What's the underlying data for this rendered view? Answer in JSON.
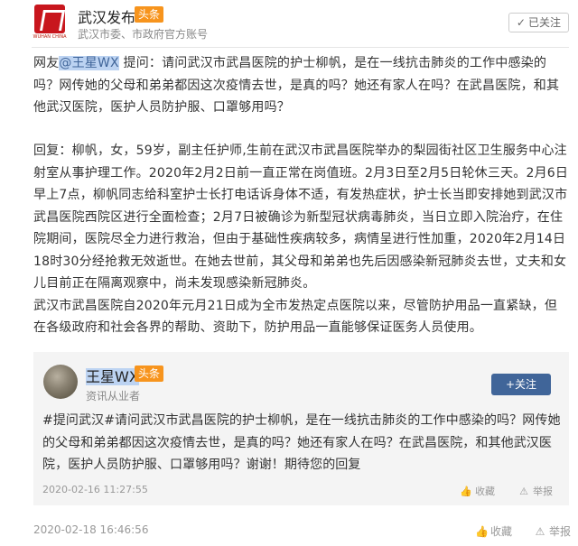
{
  "header": {
    "logo_text": "WUHAN CHINA",
    "account_name": "武汉发布",
    "badge": "头条",
    "account_desc": "武汉市委、市政府官方账号",
    "follow_label": "已关注"
  },
  "question": {
    "prefix": "网友",
    "mention": "@王星WX",
    "body": " 提问：请问武汉市武昌医院的护士柳帆，是在一线抗击肺炎的工作中感染的吗？网传她的父母和弟弟都因这次疫情去世，是真的吗？她还有家人在吗？在武昌医院，和其他武汉医院，医护人员防护服、口罩够用吗？"
  },
  "answer": {
    "para1": "回复：柳帆，女，59岁，副主任护师,生前在武汉市武昌医院举办的梨园街社区卫生服务中心注射室从事护理工作。2020年2月2日前一直正常在岗值班。2月3日至2月5日轮休三天。2月6日早上7点，柳帆同志给科室护士长打电话诉身体不适，有发热症状，护士长当即安排她到武汉市武昌医院西院区进行全面检查；2月7日被确诊为新型冠状病毒肺炎，当日立即入院治疗，在住院期间，医院尽全力进行救治，但由于基础性疾病较多，病情呈进行性加重，2020年2月14日18时30分经抢救无效逝世。在她去世前，其父母和弟弟也先后因感染新冠肺炎去世，丈夫和女儿目前正在隔离观察中，尚未发现感染新冠肺炎。",
    "para2": "武汉市武昌医院自2020年元月21日成为全市发热定点医院以来，尽管防护用品一直紧缺，但在各级政府和社会各界的帮助、资助下，防护用品一直能够保证医务人员使用。"
  },
  "card": {
    "user_name": "王星WX",
    "badge": "头条",
    "user_desc": "资讯从业者",
    "follow_label": "+关注",
    "text": "#提问武汉#请问武汉市武昌医院的护士柳帆，是在一线抗击肺炎的工作中感染的吗？网传她的父母和弟弟都因这次疫情去世，是真的吗？她还有家人在吗？在武昌医院，和其他武汉医院，医护人员防护服、口罩够用吗？谢谢！期待您的回复",
    "time": "2020-02-16 11:27:55",
    "fav_label": "收藏",
    "report_label": "举报"
  },
  "footer": {
    "time": "2020-02-18 16:46:56",
    "fav_label": "收藏",
    "report_label": "举报"
  },
  "icons": {
    "fav": "thumbs-up-icon",
    "report": "report-icon",
    "check": "check-icon"
  }
}
